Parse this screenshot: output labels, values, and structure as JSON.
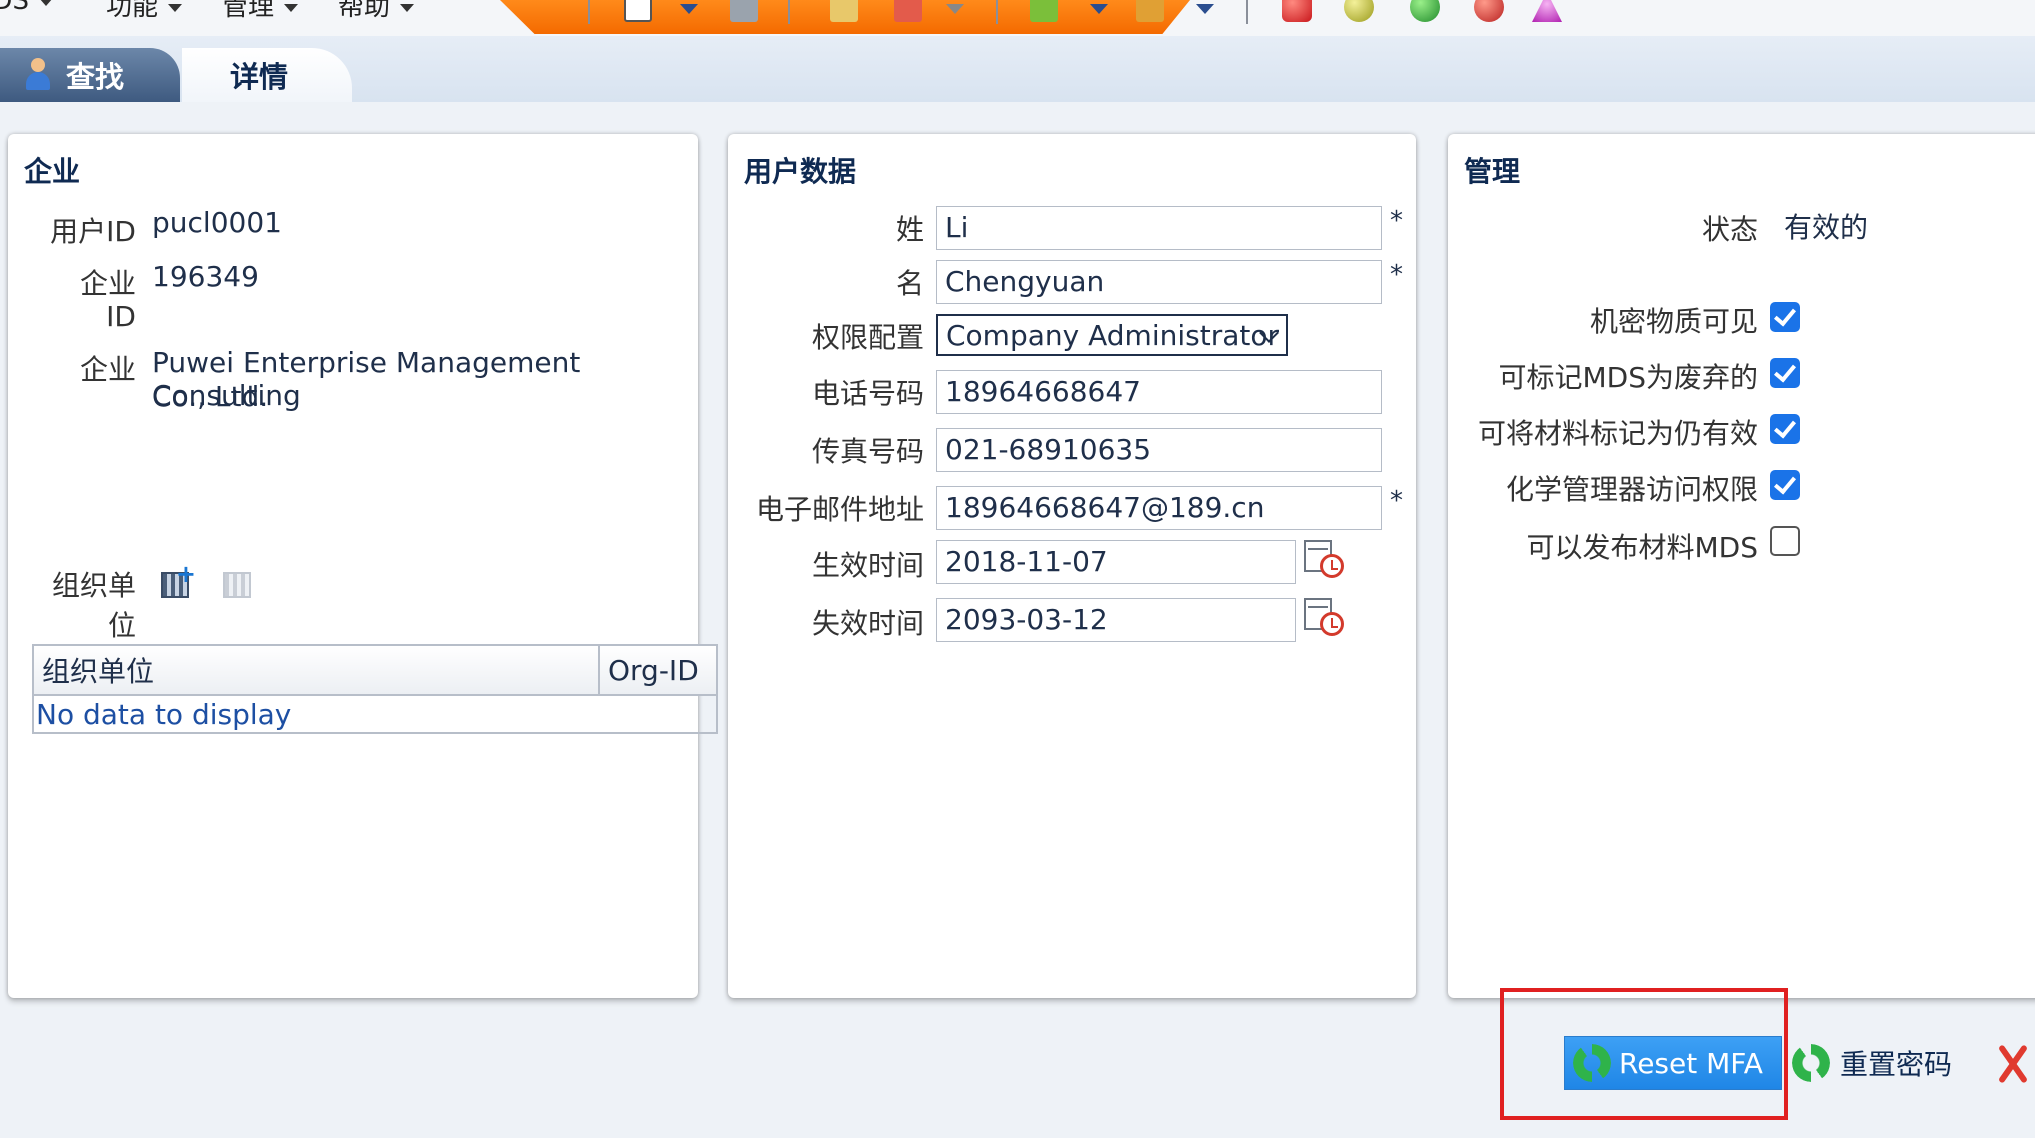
{
  "menu": {
    "items": [
      {
        "label": "MDS"
      },
      {
        "label": "功能"
      },
      {
        "label": "管理"
      },
      {
        "label": "帮助"
      }
    ]
  },
  "tabs": {
    "search": "查找",
    "detail": "详情"
  },
  "enterprise": {
    "title": "企业",
    "user_id_label": "用户ID",
    "user_id": "pucl0001",
    "enterprise_id_label_1": "企业",
    "enterprise_id_label_2": "ID",
    "enterprise_id": "196349",
    "enterprise_label": "企业",
    "enterprise_name_1": "Puwei Enterprise Management Consulting",
    "enterprise_name_2": "Co., Ltd.",
    "org_label_1": "组织单",
    "org_label_2": "位",
    "org_table": {
      "headers": [
        "组织单位",
        "Org-ID"
      ],
      "empty_text": "No data to display"
    }
  },
  "user_data": {
    "title": "用户数据",
    "fields": {
      "surname": {
        "label": "姓",
        "value": "Li"
      },
      "given_name": {
        "label": "名",
        "value": "Chengyuan"
      },
      "role": {
        "label": "权限配置",
        "value": "Company Administrator"
      },
      "phone": {
        "label": "电话号码",
        "value": "18964668647"
      },
      "fax": {
        "label": "传真号码",
        "value": "021-68910635"
      },
      "email": {
        "label": "电子邮件地址",
        "value": "18964668647@189.cn"
      },
      "valid_from": {
        "label": "生效时间",
        "value": "2018-11-07"
      },
      "valid_to": {
        "label": "失效时间",
        "value": "2093-03-12"
      }
    },
    "required_marker": "*"
  },
  "management": {
    "title": "管理",
    "status_label": "状态",
    "status_value": "有效的",
    "options": [
      {
        "label": "机密物质可见",
        "checked": true
      },
      {
        "label": "可标记MDS为废弃的",
        "checked": true
      },
      {
        "label": "可将材料标记为仍有效",
        "checked": true
      },
      {
        "label": "化学管理器访问权限",
        "checked": true
      },
      {
        "label": "可以发布材料MDS",
        "checked": false
      }
    ]
  },
  "actions": {
    "reset_mfa": "Reset MFA",
    "reset_password": "重置密码"
  },
  "colors": {
    "accent_blue": "#1f86e6",
    "checkbox_blue": "#1a73e8",
    "highlight_red": "#e02020",
    "toolbar_orange": "#f46a00"
  }
}
